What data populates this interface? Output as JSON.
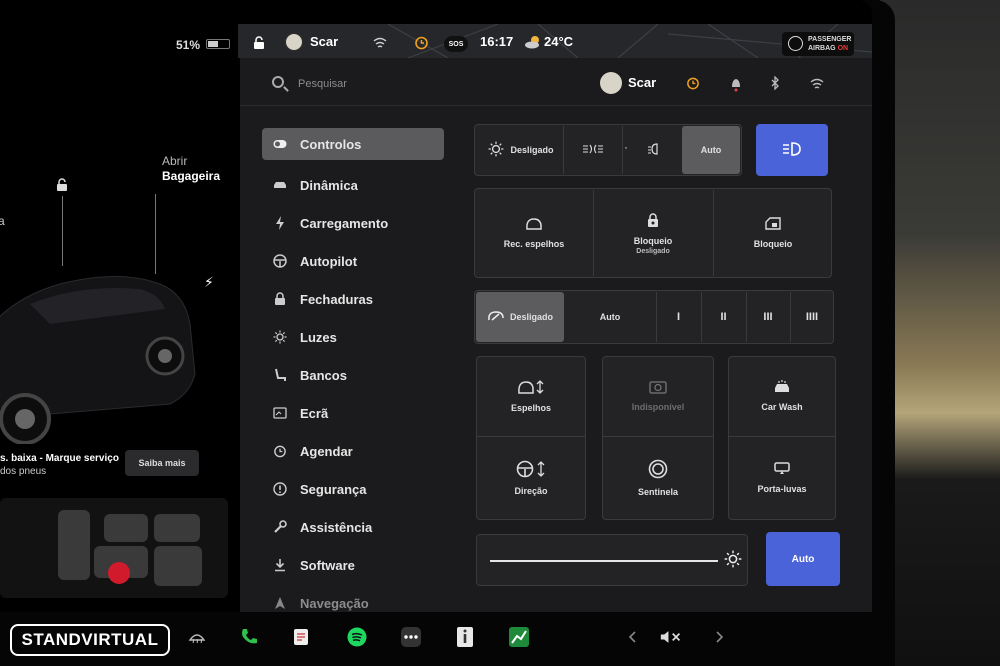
{
  "status_bar": {
    "battery_percent": "51%",
    "battery_level": 0.51,
    "driver_name": "Scar",
    "time": "16:17",
    "temperature": "24°C",
    "sos_label": "SOS",
    "airbag": {
      "line1": "PASSENGER",
      "line2": "AIRBAG",
      "state": "ON"
    }
  },
  "car_panel": {
    "trunk_label_1": "Abrir",
    "trunk_label_2": "Bagageira",
    "frunk_stub": "a",
    "alert_line_1": "s. baixa - Marque serviço",
    "alert_line_2": "dos pneus",
    "learn_more": "Saiba mais"
  },
  "header": {
    "search_placeholder": "Pesquisar",
    "profile_name": "Scar"
  },
  "sidebar": {
    "items": [
      {
        "label": "Controlos",
        "icon": "toggle-icon",
        "active": true
      },
      {
        "label": "Dinâmica",
        "icon": "car-icon"
      },
      {
        "label": "Carregamento",
        "icon": "bolt-icon"
      },
      {
        "label": "Autopilot",
        "icon": "steering-wheel-icon"
      },
      {
        "label": "Fechaduras",
        "icon": "lock-icon"
      },
      {
        "label": "Luzes",
        "icon": "sun-icon"
      },
      {
        "label": "Bancos",
        "icon": "seat-icon"
      },
      {
        "label": "Ecrã",
        "icon": "display-icon"
      },
      {
        "label": "Agendar",
        "icon": "alarm-icon"
      },
      {
        "label": "Segurança",
        "icon": "info-icon"
      },
      {
        "label": "Assistência",
        "icon": "wrench-icon"
      },
      {
        "label": "Software",
        "icon": "download-icon"
      },
      {
        "label": "Navegação",
        "icon": "navigation-icon"
      }
    ]
  },
  "lights": {
    "off_label": "Desligado",
    "dot": "·",
    "auto_label": "Auto",
    "selected": "Auto"
  },
  "tiles_row1": [
    {
      "label": "Rec. espelhos",
      "sub": ""
    },
    {
      "label": "Bloqueio",
      "sub": "Desligado"
    },
    {
      "label": "Bloqueio",
      "sub": ""
    }
  ],
  "wipers": {
    "off_label": "Desligado",
    "auto_label": "Auto",
    "speeds": [
      "I",
      "II",
      "III",
      "IIII"
    ],
    "selected": "Desligado"
  },
  "tiles_grid": [
    {
      "label": "Espelhos"
    },
    {
      "label": "Indisponível"
    },
    {
      "label": "Car Wash"
    },
    {
      "label": "Direção"
    },
    {
      "label": "Sentinela"
    },
    {
      "label": "Porta-luvas"
    }
  ],
  "brightness": {
    "auto_label": "Auto"
  },
  "taskbar": {
    "watermark": "STANDVIRTUAL",
    "icons": [
      "defrost-icon",
      "phone-icon",
      "notepad-icon",
      "spotify-icon",
      "more-icon",
      "info-app-icon",
      "chart-app-icon",
      "chevron-left-icon",
      "mute-icon",
      "chevron-right-icon"
    ]
  },
  "colors": {
    "accent_blue": "#4b63d8",
    "panel": "#1b1b1d",
    "selected": "#5b5b5e",
    "alert_red": "#d11b2c"
  }
}
